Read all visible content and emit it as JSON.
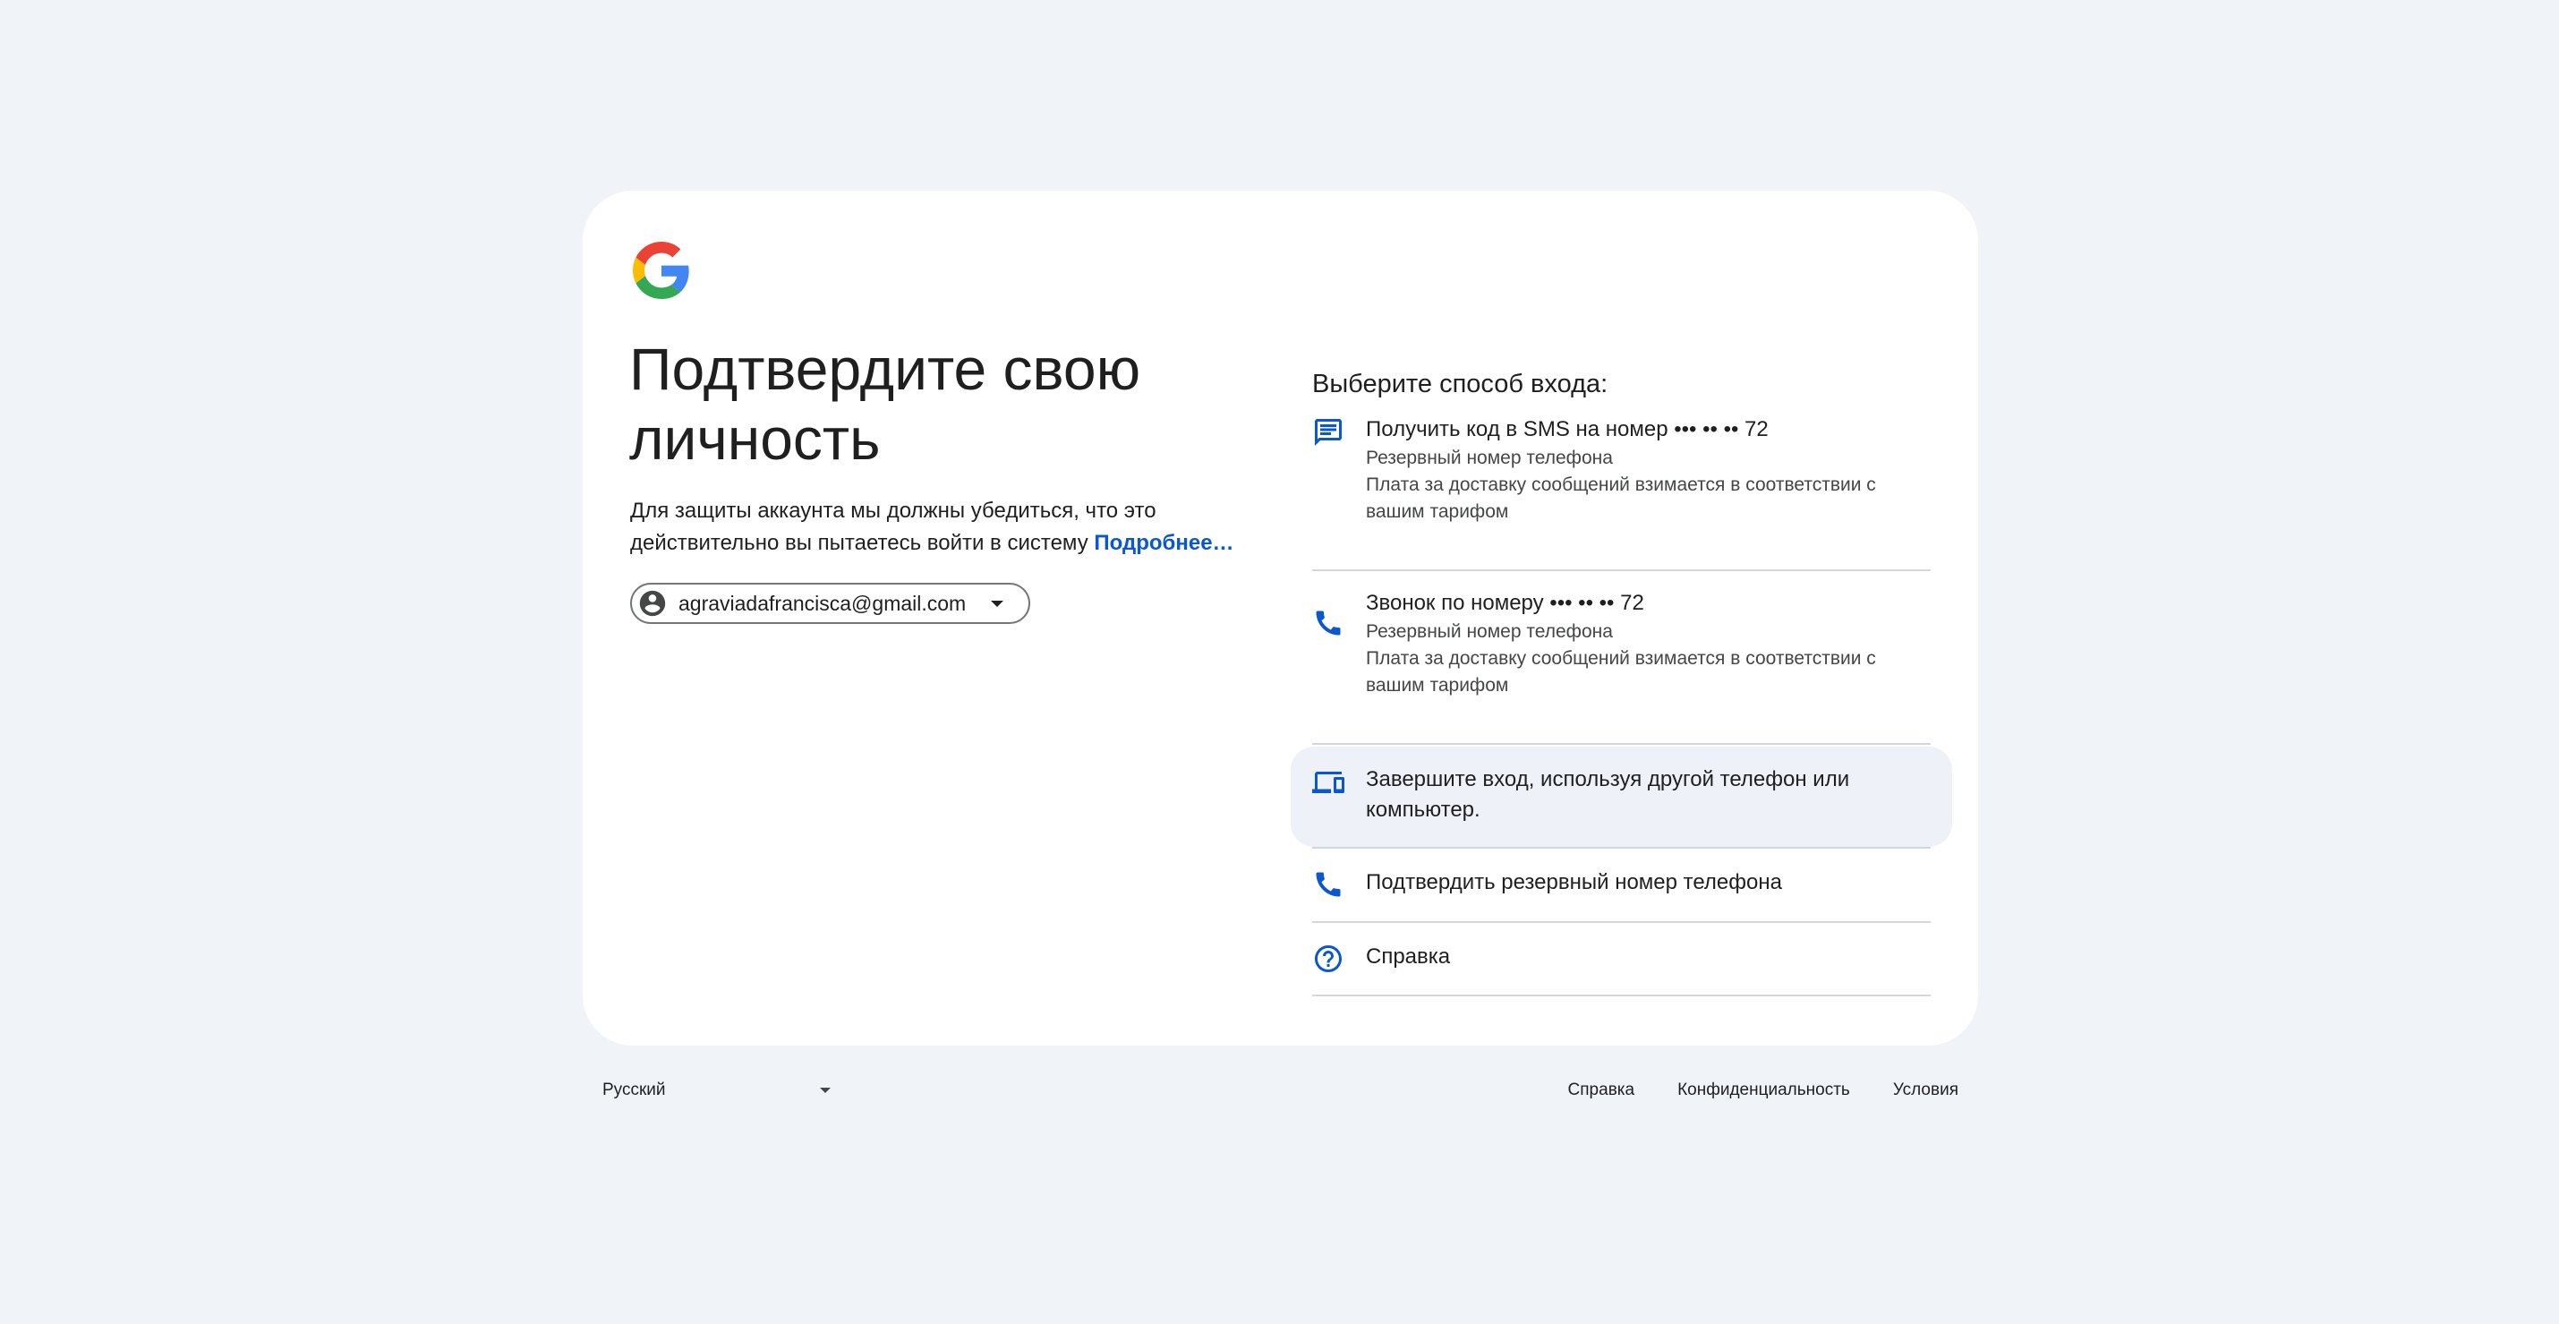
{
  "card": {
    "title": "Подтвердите свою личность",
    "description": "Для защиты аккаунта мы должны убедиться, что это действительно вы пытаетесь войти в систему",
    "learn_more": "Подробнее…",
    "account_email": "agraviadafrancisca@gmail.com"
  },
  "options": {
    "heading": "Выберите способ входа:",
    "sms": {
      "title": "Получить код в SMS на номер ••• •• •• 72",
      "sub1": "Резервный номер телефона",
      "sub2": "Плата за доставку сообщений взимается в соответствии с вашим тарифом"
    },
    "call": {
      "title": "Звонок по номеру ••• •• •• 72",
      "sub1": "Резервный номер телефона",
      "sub2": "Плата за доставку сообщений взимается в соответствии с вашим тарифом"
    },
    "device": {
      "title": "Завершите вход, используя другой телефон или компьютер."
    },
    "backup_phone": {
      "title": "Подтвердить резервный номер телефона"
    },
    "help": {
      "title": "Справка"
    }
  },
  "footer": {
    "language": "Русский",
    "links": {
      "help": "Справка",
      "privacy": "Конфиденциальность",
      "terms": "Условия"
    }
  },
  "colors": {
    "background": "#f0f4f9",
    "card": "#ffffff",
    "accent_blue": "#0b57d0",
    "highlight": "#eef2f8",
    "divider": "#d3d7dc"
  },
  "icons": {
    "logo": "google-g-logo",
    "account": "account-circle-icon",
    "sms": "message-icon",
    "call": "phone-icon",
    "device": "devices-icon",
    "backup": "phone-icon",
    "help": "help-circle-icon"
  }
}
